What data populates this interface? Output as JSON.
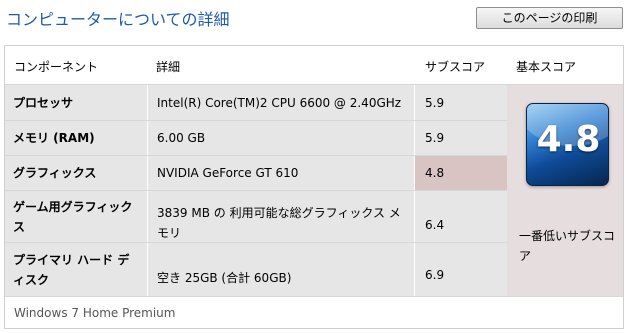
{
  "page": {
    "title": "コンピューターについての詳細",
    "print_label": "このページの印刷"
  },
  "table": {
    "headers": {
      "component": "コンポーネント",
      "detail": "詳細",
      "subscore": "サブスコア",
      "basescore": "基本スコア"
    },
    "rows": [
      {
        "name": "プロセッサ",
        "detail": "Intel(R) Core(TM)2 CPU 6600 @ 2.40GHz",
        "subscore": "5.9"
      },
      {
        "name": "メモリ (RAM)",
        "detail": "6.00 GB",
        "subscore": "5.9"
      },
      {
        "name": "グラフィックス",
        "detail": "NVIDIA GeForce GT 610",
        "subscore": "4.8"
      },
      {
        "name": "ゲーム用グラフィックス",
        "detail": "3839 MB の 利用可能な総グラフィックス メモリ",
        "subscore": "6.4"
      },
      {
        "name": "プライマリ ハード ディスク",
        "detail": "空き 25GB (合計 60GB)",
        "subscore": "6.9"
      }
    ],
    "base": {
      "score": "4.8",
      "label": "一番低いサブスコア"
    }
  },
  "footer": {
    "os": "Windows 7 Home Premium"
  },
  "colors": {
    "title": "#1e5ba8",
    "lowest_highlight": "#d9c4c4",
    "badge": "#0f4c9a"
  }
}
